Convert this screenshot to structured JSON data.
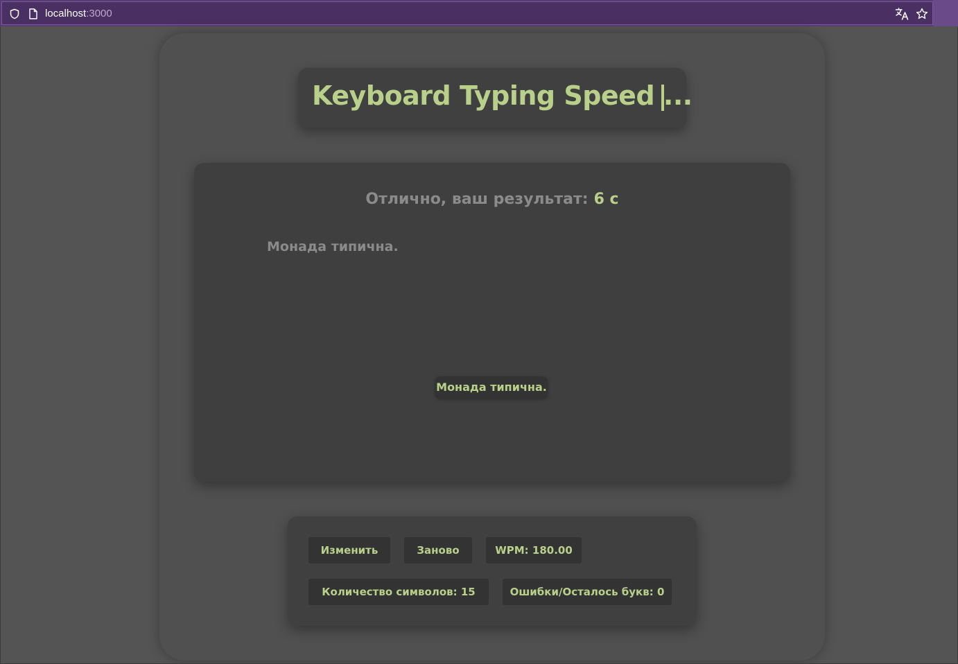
{
  "browser": {
    "url_host": "localhost",
    "url_port": ":3000",
    "icons": [
      "shield-icon",
      "page-icon",
      "translate-icon",
      "star-icon"
    ],
    "accent_color": "#5b3b73"
  },
  "app": {
    "title": "Keyboard Typing Speed ...",
    "result_label": "Отлично, ваш результат:",
    "result_value": "6 с",
    "source_text": "Монада типична.",
    "typed_text": "Монада типична.",
    "accent_color": "#b9d08a",
    "muted_text_color": "#8b8b8b"
  },
  "controls": {
    "change_label": "Изменить",
    "restart_label": "Заново",
    "wpm": "WPM: 180.00",
    "char_count": "Количество символов: 15",
    "errors_remaining": "Ошибки/Осталось букв: 0"
  }
}
